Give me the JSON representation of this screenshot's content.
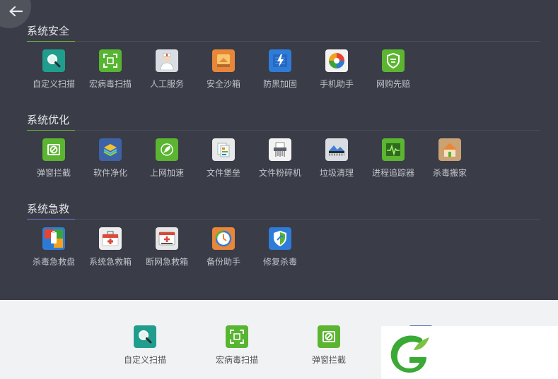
{
  "sections": [
    {
      "title": "系统安全",
      "accent": "#6fbf3b",
      "items": [
        {
          "label": "自定义扫描",
          "icon": "magnifier-icon",
          "bg": "#1f9e8e"
        },
        {
          "label": "宏病毒扫描",
          "icon": "scan-frame-icon",
          "bg": "#57b531"
        },
        {
          "label": "人工服务",
          "icon": "doctor-icon",
          "bg": "#d9dde2"
        },
        {
          "label": "安全沙箱",
          "icon": "sandbox-icon",
          "bg": "#e8863a"
        },
        {
          "label": "防黑加固",
          "icon": "lightning-shield-icon",
          "bg": "#2f7bd8"
        },
        {
          "label": "手机助手",
          "icon": "phone-ball-icon",
          "bg": "#f2f2f2"
        },
        {
          "label": "网购先赔",
          "icon": "shopping-shield-icon",
          "bg": "#5cb531"
        }
      ]
    },
    {
      "title": "系统优化",
      "accent": "#6fbf3b",
      "items": [
        {
          "label": "弹窗拦截",
          "icon": "popup-block-icon",
          "bg": "#5cb531"
        },
        {
          "label": "软件净化",
          "icon": "layers-icon",
          "bg": "#3d63a6"
        },
        {
          "label": "上网加速",
          "icon": "rocket-icon",
          "bg": "#5cb531"
        },
        {
          "label": "文件堡垒",
          "icon": "file-fortress-icon",
          "bg": "#e9e9e9"
        },
        {
          "label": "文件粉碎机",
          "icon": "shredder-icon",
          "bg": "#f2f2f2"
        },
        {
          "label": "垃圾清理",
          "icon": "cleanup-icon",
          "bg": "#d9dde2"
        },
        {
          "label": "进程追踪器",
          "icon": "process-monitor-icon",
          "bg": "#5cb531"
        },
        {
          "label": "杀毒搬家",
          "icon": "move-house-icon",
          "bg": "#caa273"
        }
      ]
    },
    {
      "title": "系统急救",
      "accent": "#6a7fe0",
      "items": [
        {
          "label": "杀毒急救盘",
          "icon": "usb-rescue-icon",
          "bg": "#2f7bd8"
        },
        {
          "label": "系统急救箱",
          "icon": "first-aid-kit-icon",
          "bg": "#eeeeee"
        },
        {
          "label": "断网急救箱",
          "icon": "network-aid-kit-icon",
          "bg": "#e6e6e6"
        },
        {
          "label": "备份助手",
          "icon": "backup-clock-icon",
          "bg": "#e8863a"
        },
        {
          "label": "修复杀毒",
          "icon": "repair-shield-icon",
          "bg": "#2f7bd8"
        }
      ]
    }
  ],
  "dock": [
    {
      "label": "自定义扫描",
      "icon": "magnifier-icon",
      "bg": "#1f9e8e"
    },
    {
      "label": "宏病毒扫描",
      "icon": "scan-frame-icon",
      "bg": "#57b531"
    },
    {
      "label": "弹窗拦截",
      "icon": "popup-block-icon",
      "bg": "#5cb531"
    }
  ],
  "logo": {
    "icon": "green-leaf-logo-icon",
    "color": "#3aa935"
  }
}
